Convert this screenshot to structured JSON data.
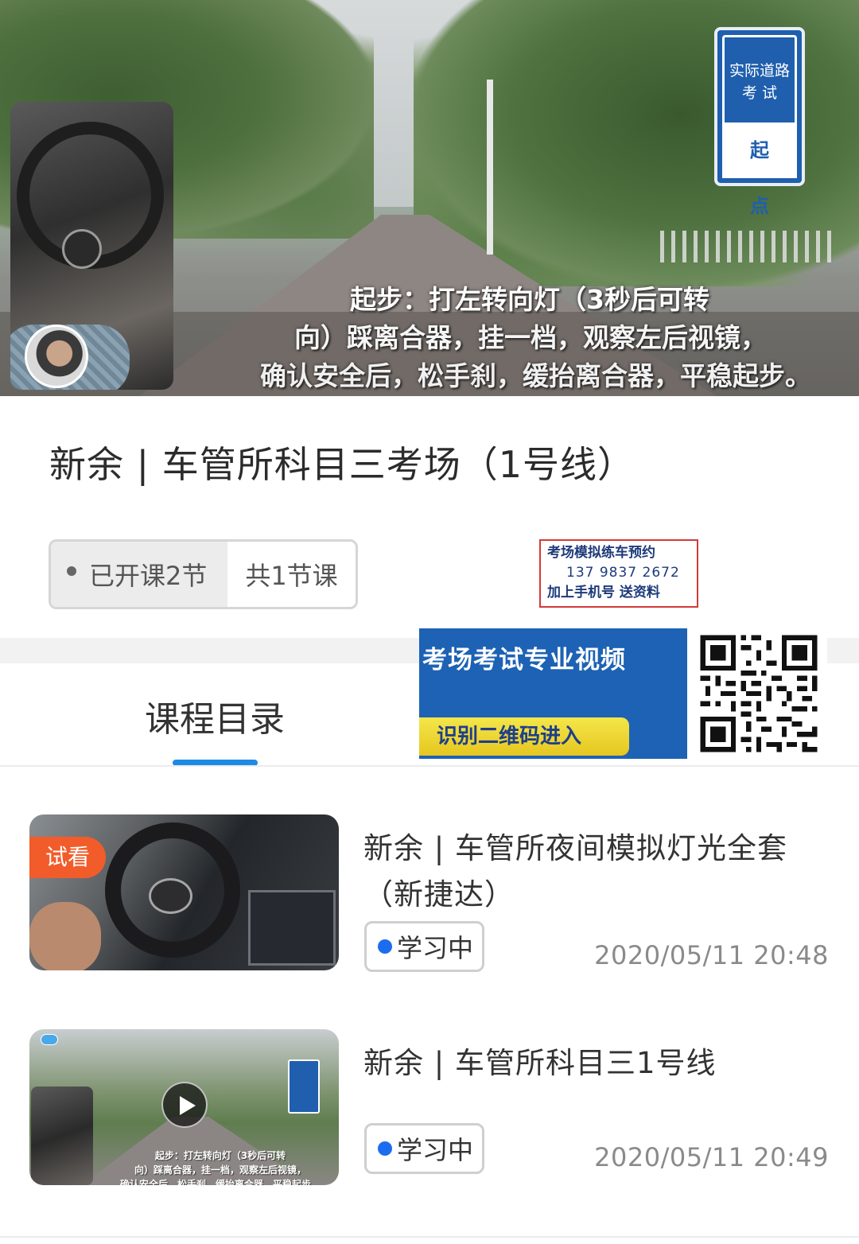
{
  "hero": {
    "sign_top": "实际道路 考 试",
    "sign_bottom": "起 点",
    "caption_line1": "起步：打左转向灯（3秒后可转",
    "caption_line2": "向）踩离合器，挂一档，观察左后视镜，",
    "caption_line3": "确认安全后，松手刹，缓抬离合器，平稳起步。"
  },
  "course": {
    "title": "新余 | 车管所科目三考场（1号线）",
    "opened_label": "已开课2节",
    "total_label": "共1节课"
  },
  "ad": {
    "line1": "考场模拟练车预约",
    "line2": "137  9837  2672",
    "line3": "加上手机号    送资料"
  },
  "promo": {
    "headline": "考场考试专业视频",
    "cta": "识别二维码进入"
  },
  "tabs": {
    "catalog": "课程目录"
  },
  "lessons": [
    {
      "tag": "试看",
      "title": "新余 | 车管所夜间模拟灯光全套（新捷达）",
      "status": "学习中",
      "time": "2020/05/11 20:48"
    },
    {
      "title": "新余 | 车管所科目三1号线",
      "status": "学习中",
      "time": "2020/05/11 20:49",
      "thumb_caption_1": "起步：打左转向灯（3秒后可转",
      "thumb_caption_2": "向）踩离合器，挂一档，观察左后视镜，",
      "thumb_caption_3": "确认安全后，松手刹，缓抬离合器，平稳起步。"
    }
  ],
  "colors": {
    "accent": "#1e8ae6",
    "status_dot": "#1c6cf0",
    "trial_tag": "#f25c2a",
    "promo_blue": "#1d62b4"
  }
}
